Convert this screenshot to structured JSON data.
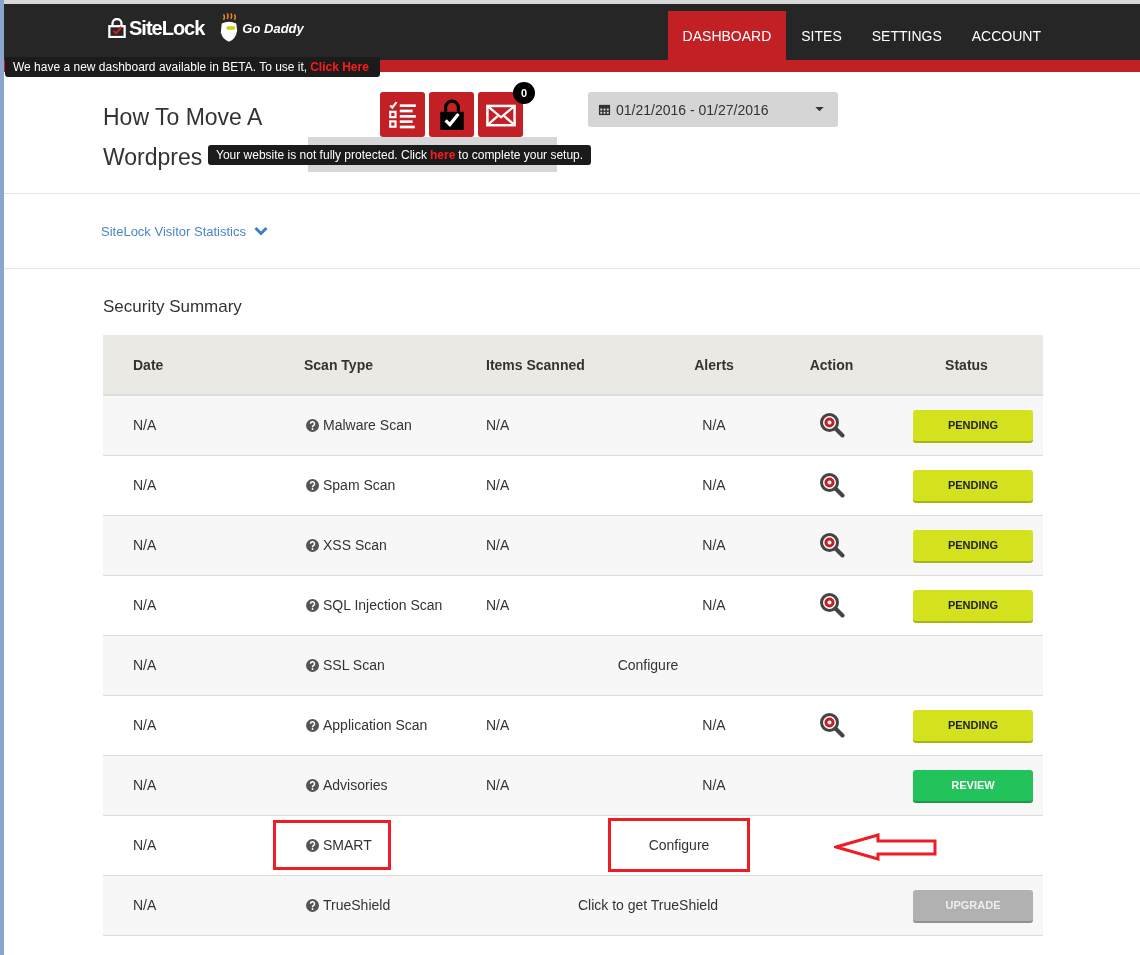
{
  "header": {
    "logo": "SiteLock",
    "partner": "Go Daddy",
    "nav": [
      {
        "label": "DASHBOARD",
        "selected": true
      },
      {
        "label": "SITES",
        "selected": false
      },
      {
        "label": "SETTINGS",
        "selected": false
      },
      {
        "label": "ACCOUNT",
        "selected": false
      }
    ],
    "beta_notice": {
      "text": "We have a new dashboard available in BETA. To use it,",
      "link": "Click Here"
    }
  },
  "site": {
    "title_lines": [
      "How To Move A",
      "Wordpres"
    ],
    "mail_count": "0",
    "setup_notice": {
      "before": "Your website is not fully protected. Click",
      "link": "here",
      "after": "to complete your setup."
    },
    "date_range": "01/21/2016 - 01/27/2016"
  },
  "visitor_statistics": {
    "label": "SiteLock Visitor Statistics",
    "expanded": false
  },
  "security_summary": {
    "title": "Security Summary",
    "columns": [
      "Date",
      "Scan Type",
      "Items Scanned",
      "Alerts",
      "Action",
      "Status"
    ],
    "rows": [
      {
        "date": "N/A",
        "scan_type": "Malware Scan",
        "kind": "scan",
        "items": "N/A",
        "alerts": "N/A",
        "action": true,
        "status": {
          "label": "PENDING",
          "kind": "pending"
        },
        "highlighted": false
      },
      {
        "date": "N/A",
        "scan_type": "Spam Scan",
        "kind": "scan",
        "items": "N/A",
        "alerts": "N/A",
        "action": true,
        "status": {
          "label": "PENDING",
          "kind": "pending"
        },
        "highlighted": false
      },
      {
        "date": "N/A",
        "scan_type": "XSS Scan",
        "kind": "scan",
        "items": "N/A",
        "alerts": "N/A",
        "action": true,
        "status": {
          "label": "PENDING",
          "kind": "pending"
        },
        "highlighted": false
      },
      {
        "date": "N/A",
        "scan_type": "SQL Injection Scan",
        "kind": "scan",
        "items": "N/A",
        "alerts": "N/A",
        "action": true,
        "status": {
          "label": "PENDING",
          "kind": "pending"
        },
        "highlighted": false
      },
      {
        "date": "N/A",
        "scan_type": "SSL Scan",
        "kind": "note",
        "note": "Configure",
        "highlighted": false
      },
      {
        "date": "N/A",
        "scan_type": "Application Scan",
        "kind": "scan",
        "items": "N/A",
        "alerts": "N/A",
        "action": true,
        "status": {
          "label": "PENDING",
          "kind": "pending"
        },
        "highlighted": false
      },
      {
        "date": "N/A",
        "scan_type": "Advisories",
        "kind": "scan",
        "items": "N/A",
        "alerts": "N/A",
        "action": false,
        "status": {
          "label": "REVIEW",
          "kind": "review"
        },
        "highlighted": false
      },
      {
        "date": "N/A",
        "scan_type": "SMART",
        "kind": "note",
        "note": "Configure",
        "highlighted": true
      },
      {
        "date": "N/A",
        "scan_type": "TrueShield",
        "kind": "note",
        "note": "Click to get TrueShield",
        "status": {
          "label": "UPGRADE",
          "kind": "upgrade"
        },
        "highlighted": false
      }
    ]
  }
}
